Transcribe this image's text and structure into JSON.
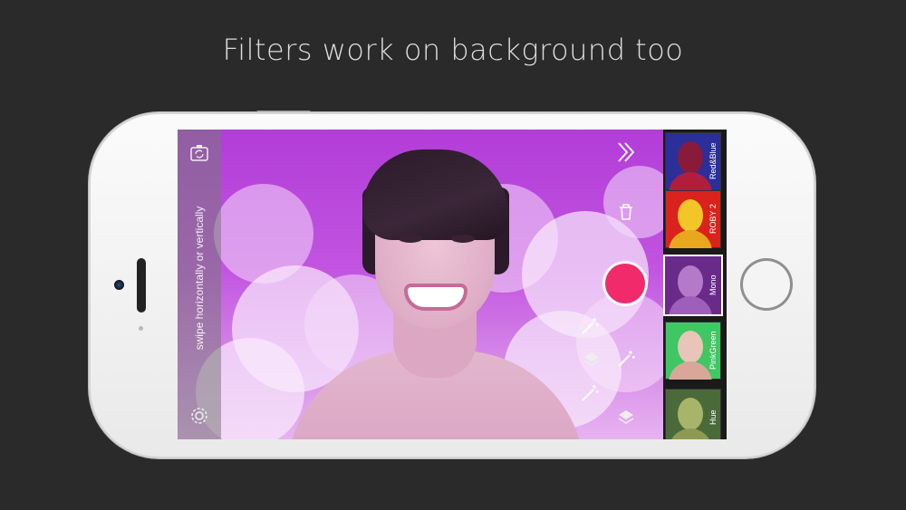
{
  "headline": "Filters work on background too",
  "screen": {
    "swipe_hint": "swipe horizontally or vertically",
    "left_icons": [
      "camera-switch-icon",
      "gear-icon"
    ],
    "right_icons": [
      "double-chevron-right-icon",
      "trash-icon",
      "magic-wand-icon",
      "layers-icon"
    ]
  },
  "filters": [
    {
      "label": "Red&Blue",
      "bg": "#2b2f9a",
      "head": "#8a1a3a",
      "body": "#b01d3d",
      "active": false
    },
    {
      "label": "ROBY 2",
      "bg": "#d9231c",
      "head": "#f2c528",
      "body": "#e8a71f",
      "active": false
    },
    {
      "label": "Mono",
      "bg": "#6a2a8a",
      "head": "#b479c9",
      "body": "#9e5fba",
      "active": true
    },
    {
      "label": "PinkGreen",
      "bg": "#3ec763",
      "head": "#e8c5b8",
      "body": "#d8a79a",
      "active": false
    },
    {
      "label": "Hue",
      "bg": "#4a6a3a",
      "head": "#a8b46a",
      "body": "#8e9a54",
      "active": false
    }
  ],
  "colors": {
    "record": "#f02a6b",
    "background": "#2a2a2a"
  }
}
